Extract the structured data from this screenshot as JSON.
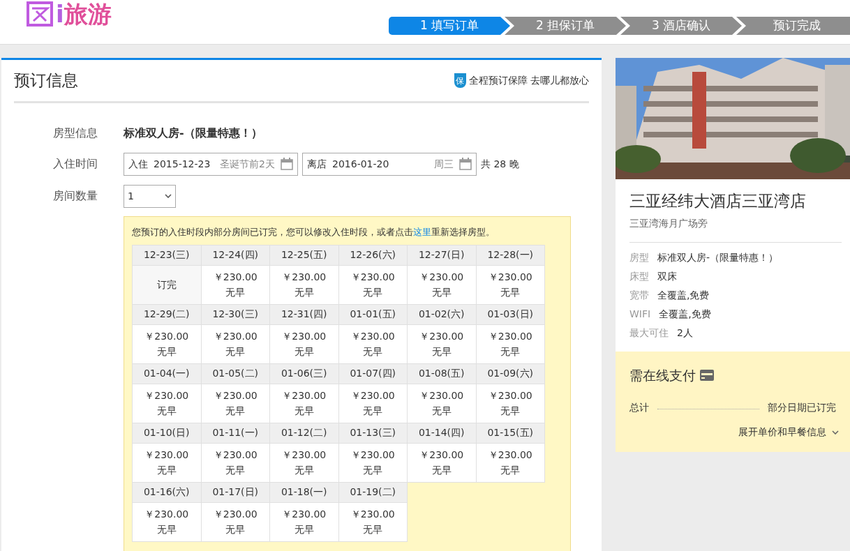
{
  "logo": {
    "text_plain": "i",
    "text_accent": "旅游"
  },
  "steps": [
    {
      "label": "1 填写订单",
      "selected": true
    },
    {
      "label": "2 担保订单",
      "selected": false
    },
    {
      "label": "3 酒店确认",
      "selected": false
    },
    {
      "label": "预订完成",
      "selected": false
    }
  ],
  "booking": {
    "title": "预订信息",
    "guarantee_badge": "保",
    "guarantee": "全程预订保障 去哪儿都放心",
    "room_type_label": "房型信息",
    "room_type": "标准双人房-（限量特惠！）",
    "stay_label": "入住时间",
    "checkin_prefix": "入住",
    "checkin": "2015-12-23",
    "checkin_note": "圣诞节前2天",
    "checkout_prefix": "离店",
    "checkout": "2016-01-20",
    "checkout_note": "周三",
    "nights": "共 28 晚",
    "rooms_label": "房间数量",
    "rooms": "1"
  },
  "notice": {
    "text_before": "您预订的入住时段内部分房间已订完，您可以修改入住时段，或者点击",
    "link": "这里",
    "text_after": "重新选择房型。"
  },
  "days": [
    {
      "date": "12-23(三)",
      "kind": "sold",
      "status": "订完"
    },
    {
      "date": "12-24(四)",
      "kind": "available",
      "price": "￥230.00",
      "meal": "无早"
    },
    {
      "date": "12-25(五)",
      "kind": "available",
      "price": "￥230.00",
      "meal": "无早"
    },
    {
      "date": "12-26(六)",
      "kind": "available",
      "price": "￥230.00",
      "meal": "无早"
    },
    {
      "date": "12-27(日)",
      "kind": "available",
      "price": "￥230.00",
      "meal": "无早"
    },
    {
      "date": "12-28(一)",
      "kind": "available",
      "price": "￥230.00",
      "meal": "无早"
    },
    {
      "date": "12-29(二)",
      "kind": "available",
      "price": "￥230.00",
      "meal": "无早"
    },
    {
      "date": "12-30(三)",
      "kind": "available",
      "price": "￥230.00",
      "meal": "无早"
    },
    {
      "date": "12-31(四)",
      "kind": "available",
      "price": "￥230.00",
      "meal": "无早"
    },
    {
      "date": "01-01(五)",
      "kind": "available",
      "price": "￥230.00",
      "meal": "无早"
    },
    {
      "date": "01-02(六)",
      "kind": "available",
      "price": "￥230.00",
      "meal": "无早"
    },
    {
      "date": "01-03(日)",
      "kind": "available",
      "price": "￥230.00",
      "meal": "无早"
    },
    {
      "date": "01-04(一)",
      "kind": "available",
      "price": "￥230.00",
      "meal": "无早"
    },
    {
      "date": "01-05(二)",
      "kind": "available",
      "price": "￥230.00",
      "meal": "无早"
    },
    {
      "date": "01-06(三)",
      "kind": "available",
      "price": "￥230.00",
      "meal": "无早"
    },
    {
      "date": "01-07(四)",
      "kind": "available",
      "price": "￥230.00",
      "meal": "无早"
    },
    {
      "date": "01-08(五)",
      "kind": "available",
      "price": "￥230.00",
      "meal": "无早"
    },
    {
      "date": "01-09(六)",
      "kind": "available",
      "price": "￥230.00",
      "meal": "无早"
    },
    {
      "date": "01-10(日)",
      "kind": "available",
      "price": "￥230.00",
      "meal": "无早"
    },
    {
      "date": "01-11(一)",
      "kind": "available",
      "price": "￥230.00",
      "meal": "无早"
    },
    {
      "date": "01-12(二)",
      "kind": "available",
      "price": "￥230.00",
      "meal": "无早"
    },
    {
      "date": "01-13(三)",
      "kind": "available",
      "price": "￥230.00",
      "meal": "无早"
    },
    {
      "date": "01-14(四)",
      "kind": "available",
      "price": "￥230.00",
      "meal": "无早"
    },
    {
      "date": "01-15(五)",
      "kind": "available",
      "price": "￥230.00",
      "meal": "无早"
    },
    {
      "date": "01-16(六)",
      "kind": "available",
      "price": "￥230.00",
      "meal": "无早"
    },
    {
      "date": "01-17(日)",
      "kind": "available",
      "price": "￥230.00",
      "meal": "无早"
    },
    {
      "date": "01-18(一)",
      "kind": "available",
      "price": "￥230.00",
      "meal": "无早"
    },
    {
      "date": "01-19(二)",
      "kind": "available",
      "price": "￥230.00",
      "meal": "无早"
    }
  ],
  "hotel": {
    "name": "三亚经纬大酒店三亚湾店",
    "location": "三亚湾海月广场旁",
    "details": [
      {
        "label": "房型",
        "value": "标准双人房-（限量特惠！）"
      },
      {
        "label": "床型",
        "value": "双床"
      },
      {
        "label": "宽带",
        "value": "全覆盖,免费"
      },
      {
        "label": "WIFI",
        "value": "全覆盖,免费"
      },
      {
        "label": "最大可住",
        "value": "2人"
      }
    ]
  },
  "payment": {
    "title": "需在线支付",
    "total_label": "总计",
    "total_value": "部分日期已订完",
    "expand": "展开单价和早餐信息"
  }
}
